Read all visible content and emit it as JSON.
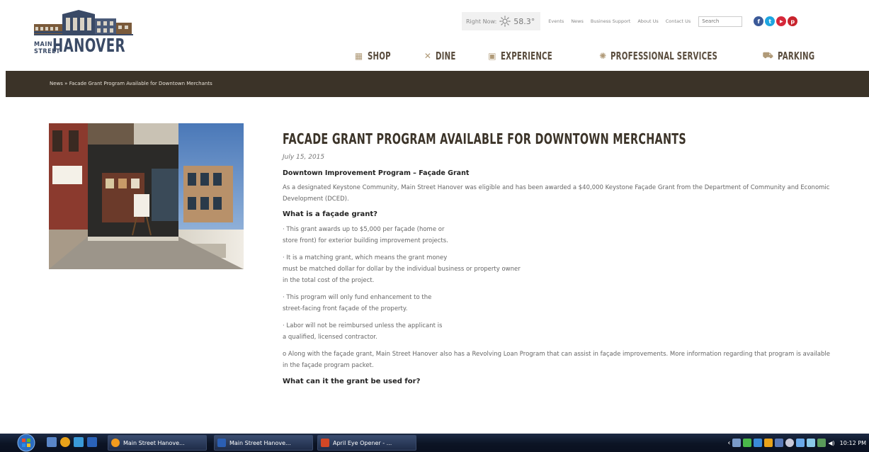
{
  "header": {
    "logo": {
      "main": "MAIN STREET",
      "hanover": "HANOVER"
    },
    "weather": {
      "label": "Right Now:",
      "temperature": "58.3°",
      "icon": "sun-icon"
    },
    "top_links": [
      "Events",
      "News",
      "Business Support",
      "About Us",
      "Contact Us"
    ],
    "search_placeholder": "Search",
    "social": [
      {
        "name": "facebook-icon",
        "color": "#3b5998",
        "glyph": "f"
      },
      {
        "name": "twitter-icon",
        "color": "#1ea5e0",
        "glyph": "t"
      },
      {
        "name": "youtube-icon",
        "color": "#d6283a",
        "glyph": "▶"
      },
      {
        "name": "pinterest-icon",
        "color": "#c8232c",
        "glyph": "p"
      }
    ],
    "main_nav": [
      {
        "label": "SHOP",
        "icon": "shop-icon"
      },
      {
        "label": "DINE",
        "icon": "dine-icon"
      },
      {
        "label": "EXPERIENCE",
        "icon": "experience-icon"
      },
      {
        "label": "PROFESSIONAL SERVICES",
        "icon": "gear-icon"
      },
      {
        "label": "PARKING",
        "icon": "car-icon"
      }
    ]
  },
  "breadcrumb": {
    "parent": "News",
    "separator": "»",
    "current": "Facade Grant Program Available for Downtown Merchants"
  },
  "article": {
    "title": "FACADE GRANT PROGRAM AVAILABLE FOR DOWNTOWN MERCHANTS",
    "date": "July 15, 2015",
    "subtitle": "Downtown Improvement Program – Façade Grant",
    "intro": "As a designated Keystone Community, Main Street Hanover was eligible and has been awarded a $40,000 Keystone Façade Grant from the Department of Community and Economic Development (DCED).",
    "heading1": "What is a façade grant?",
    "bullet1_l1": "· This grant awards up to $5,000 per façade (home or",
    "bullet1_l2": "store front) for exterior building improvement projects.",
    "bullet2_l1": "· It is a matching grant, which means the grant money",
    "bullet2_l2": "must be matched dollar for dollar by the individual business or property owner",
    "bullet2_l3": "in the total cost of the project.",
    "bullet3_l1": "· This program will only fund enhancement to the",
    "bullet3_l2": "street-facing front façade of the property.",
    "bullet4_l1": "· Labor will not be reimbursed unless the applicant is",
    "bullet4_l2": "a qualified, licensed contractor.",
    "loan": "o Along with the façade grant, Main Street Hanover also has a Revolving Loan Program that can assist in façade improvements. More information regarding that program is available in the façade program packet.",
    "heading2": "What can it the grant be used for?"
  },
  "taskbar": {
    "tasks": [
      {
        "label": "Main Street Hanove...",
        "icon": "browser-icon",
        "color": "#f29b1e"
      },
      {
        "label": "Main Street Hanove...",
        "icon": "word-icon",
        "color": "#2b5fb4"
      },
      {
        "label": "April Eye Opener - ...",
        "icon": "powerpoint-icon",
        "color": "#d24726"
      }
    ],
    "clock": "10:12 PM"
  },
  "colors": {
    "crumb_bar": "#3b3328",
    "nav_text": "#5a4d3e",
    "title": "#3b3328",
    "logo": "#3a4a66"
  }
}
